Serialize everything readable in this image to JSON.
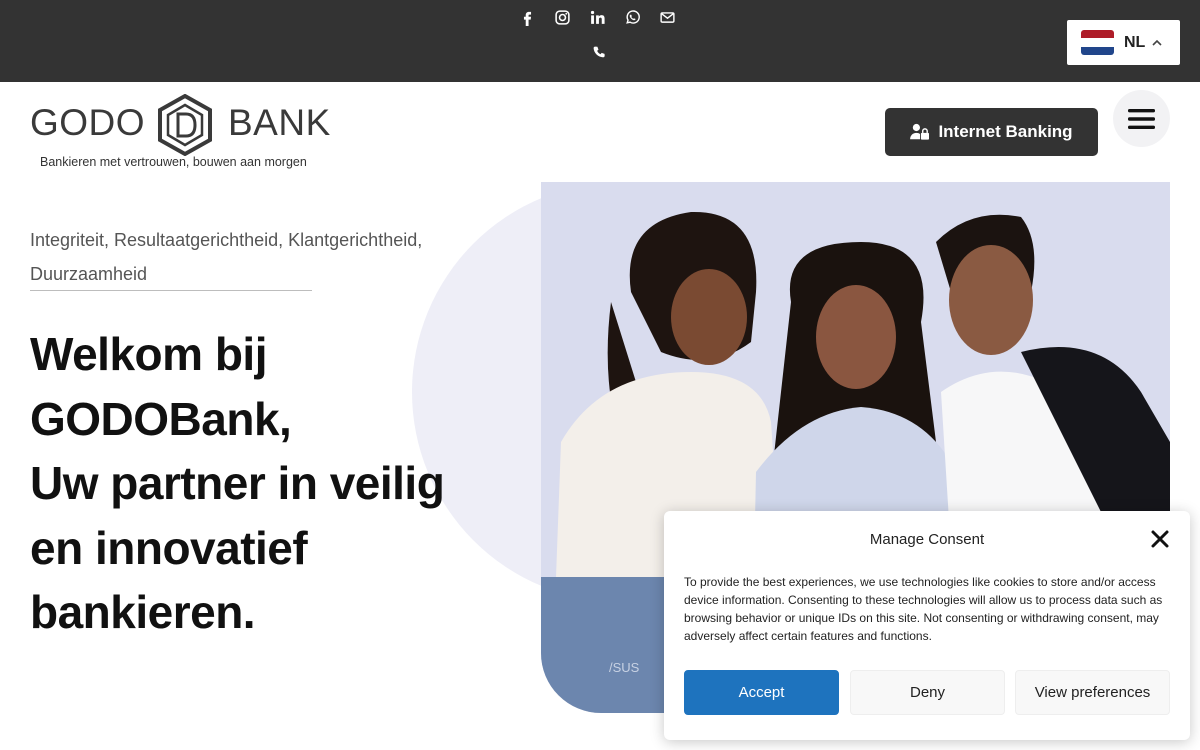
{
  "topbar": {
    "social_icons": [
      "facebook-icon",
      "instagram-icon",
      "linkedin-icon",
      "whatsapp-icon",
      "mail-icon"
    ],
    "phone_icon": "phone-icon",
    "language": {
      "code": "NL",
      "flag": "netherlands-flag",
      "flag_colors": [
        "#ae1c28",
        "#ffffff",
        "#21468b"
      ]
    }
  },
  "header": {
    "logo_left": "GODO",
    "logo_right": "BANK",
    "tagline": "Bankieren met vertrouwen, bouwen aan morgen",
    "internet_banking_label": "Internet Banking",
    "menu_icon": "hamburger-icon"
  },
  "hero": {
    "values": "Integriteit, Resultaatgerichtheid, Klantgerichtheid, Duurzaamheid",
    "headline_lines": [
      "Welkom bij",
      "GODOBank,",
      "Uw partner in veilig",
      "en innovatief",
      "bankieren."
    ],
    "laptop_brand": "/SUS"
  },
  "consent": {
    "title": "Manage Consent",
    "body": "To provide the best experiences, we use technologies like cookies to store and/or access device information. Consenting to these technologies will allow us to process data such as browsing behavior or unique IDs on this site. Not consenting or withdrawing consent, may adversely affect certain features and functions.",
    "accept_label": "Accept",
    "deny_label": "Deny",
    "preferences_label": "View preferences"
  },
  "colors": {
    "topbar": "#333333",
    "accent": "#1e73be",
    "dark_button": "#333333"
  }
}
